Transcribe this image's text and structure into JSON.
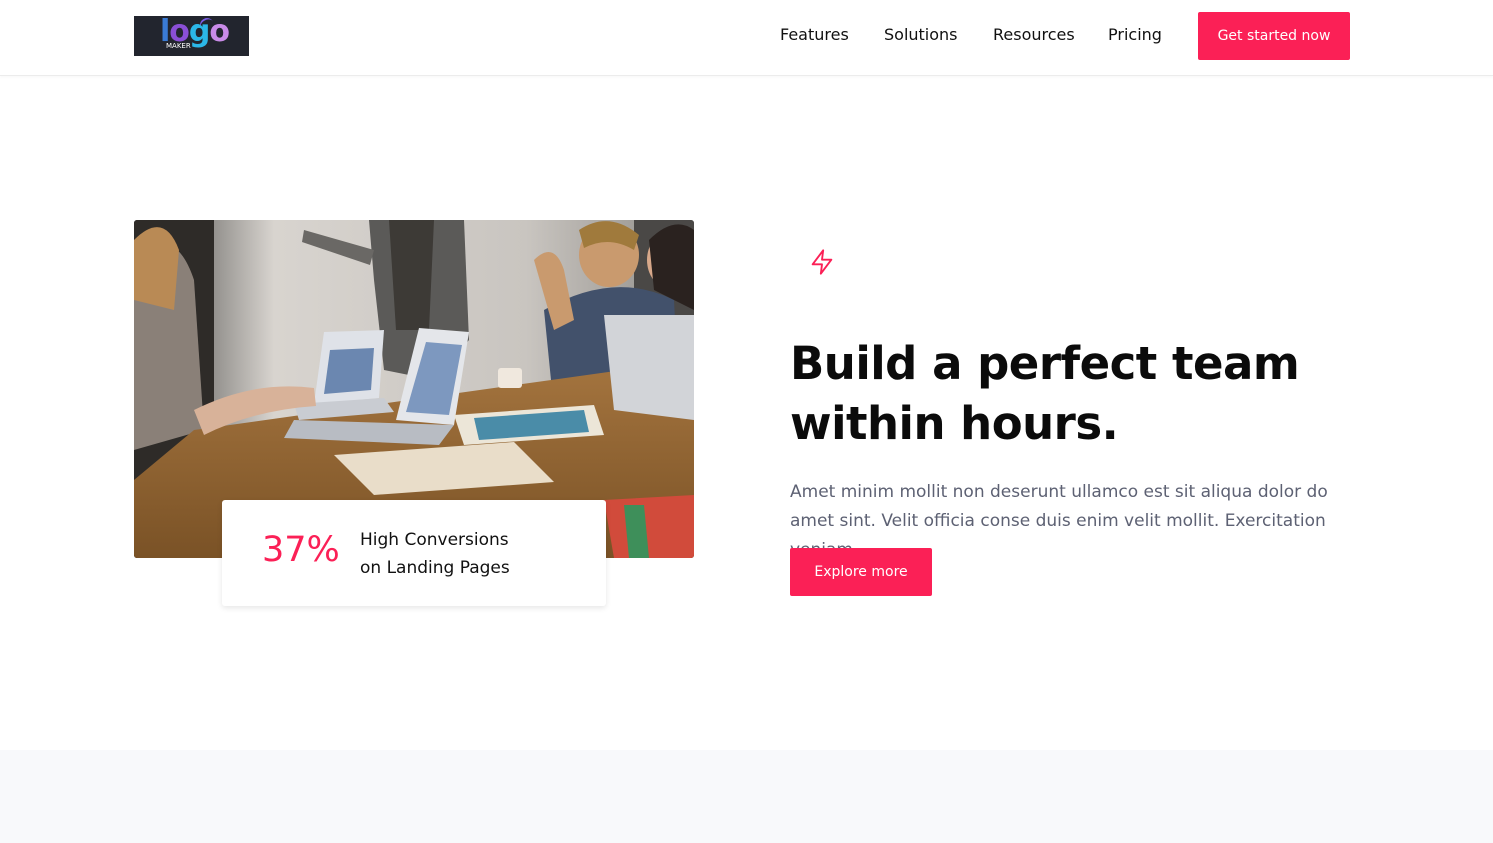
{
  "header": {
    "logo": {
      "text": "logo",
      "subtext": "MAKER"
    },
    "nav": [
      {
        "label": "Features"
      },
      {
        "label": "Solutions"
      },
      {
        "label": "Resources"
      },
      {
        "label": "Pricing"
      }
    ],
    "cta_label": "Get started now"
  },
  "hero": {
    "image": {
      "icon": "team-meeting-photo"
    },
    "stat": {
      "value": "37%",
      "label_line1": "High Conversions",
      "label_line2": "on Landing Pages"
    },
    "icon": "lightning-bolt-icon",
    "headline_line1": "Build a perfect team",
    "headline_line2": "within hours.",
    "body": "Amet minim mollit non deserunt ullamco est sit aliqua dolor do amet sint. Velit officia conse duis enim velit mollit. Exercitation veniam.",
    "button_label": "Explore more"
  },
  "colors": {
    "accent": "#fb2056",
    "heading": "#0b0b0b",
    "body_text": "#5d6173",
    "footer_band": "#f8f9fb"
  }
}
